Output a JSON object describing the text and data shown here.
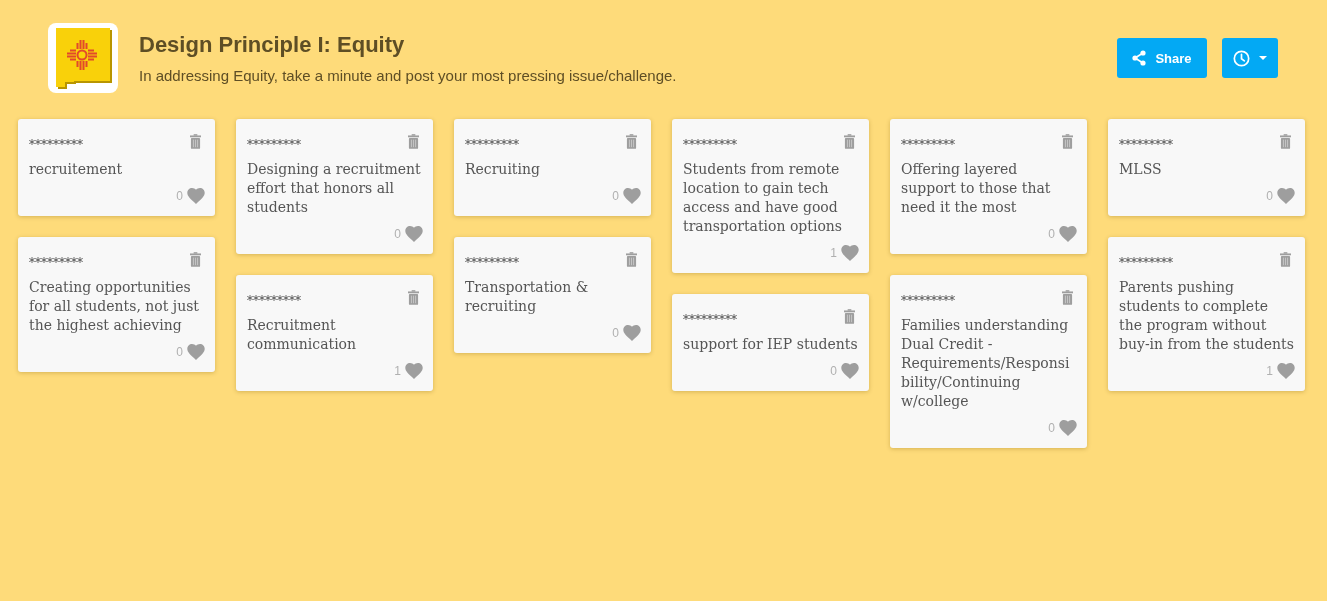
{
  "header": {
    "title": "Design Principle I: Equity",
    "subtitle": "In addressing Equity, take a minute and post your most pressing issue/challenge."
  },
  "actions": {
    "share_label": "Share"
  },
  "columns": [
    {
      "posts": [
        {
          "author": "*********",
          "text": "recruitement",
          "likes": "0"
        },
        {
          "author": "*********",
          "text": "Creating opportunities for all students, not just the highest achieving",
          "likes": "0"
        }
      ]
    },
    {
      "posts": [
        {
          "author": "*********",
          "text": "Designing a recruitment effort that honors all students",
          "likes": "0"
        },
        {
          "author": "*********",
          "text": "Recruitment communication",
          "likes": "1"
        }
      ]
    },
    {
      "posts": [
        {
          "author": "*********",
          "text": "Recruiting",
          "likes": "0"
        },
        {
          "author": "*********",
          "text": "Transportation & recruiting",
          "likes": "0"
        }
      ]
    },
    {
      "posts": [
        {
          "author": "*********",
          "text": "Students from remote location to gain tech access and have good transportation options",
          "likes": "1"
        },
        {
          "author": "*********",
          "text": "support for IEP students",
          "likes": "0"
        }
      ]
    },
    {
      "posts": [
        {
          "author": "*********",
          "text": "Offering layered support to those that need it the most",
          "likes": "0"
        },
        {
          "author": "*********",
          "text": "Families understanding Dual Credit - Requirements/Responsibility/Continuing w/college",
          "likes": "0"
        }
      ]
    },
    {
      "posts": [
        {
          "author": "*********",
          "text": "MLSS",
          "likes": "0"
        },
        {
          "author": "*********",
          "text": "Parents pushing students to complete the program without buy-in from the students",
          "likes": "1"
        }
      ]
    }
  ]
}
